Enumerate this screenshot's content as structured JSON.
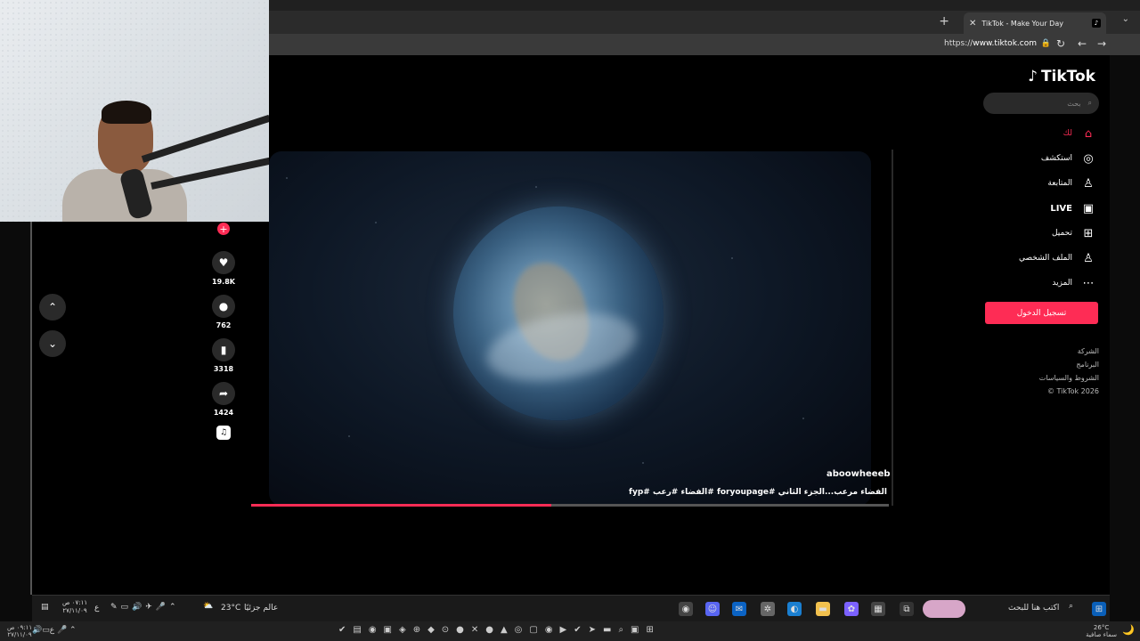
{
  "browser": {
    "tab_title": "TikTok - Make Your Day",
    "tab_close": "✕",
    "new_tab": "+",
    "tab_menu": "⌄",
    "url_prefix": "https://",
    "url_host": "www.tiktok.com"
  },
  "sidebar": {
    "logo": "TikTok",
    "search_placeholder": "بحث",
    "nav": [
      {
        "label": "لك",
        "icon": "home-icon",
        "active": true
      },
      {
        "label": "استكشف",
        "icon": "compass-icon"
      },
      {
        "label": "المتابعة",
        "icon": "user-plus-icon"
      },
      {
        "label": "LIVE",
        "icon": "live-icon"
      },
      {
        "label": "تحميل",
        "icon": "plus-square-icon"
      },
      {
        "label": "الملف الشخصي",
        "icon": "user-icon"
      },
      {
        "label": "المزيد",
        "icon": "more-icon"
      }
    ],
    "login": "تسجيل الدخول",
    "links": [
      "الشركة",
      "البرنامج",
      "الشروط والسياسات",
      "© TikTok 2026"
    ]
  },
  "video": {
    "username": "aboowheeeb",
    "caption": "الفضاء مرعب...الجزء الثاني #foryoupage #الفضاء #رعب #fyp",
    "progress": 0.47
  },
  "actions": {
    "likes": "19.8K",
    "comments": "762",
    "saves": "3318",
    "shares": "1424"
  },
  "inner_taskbar": {
    "search_placeholder": "اكتب هنا للبحث",
    "weather_temp": "23°C",
    "weather_label": "عالم جزئيًا",
    "time": "٠٧:١١ ص",
    "date": "٢٧/١١/٠٩",
    "lang": "ع"
  },
  "outer_taskbar": {
    "weather_temp": "26°C",
    "weather_label": "سماء صافية",
    "time": "٠٩:١١ ص",
    "date": "٢٧/١١/٠٩"
  },
  "colors": {
    "accent": "#fe2c55",
    "background": "#000000"
  }
}
